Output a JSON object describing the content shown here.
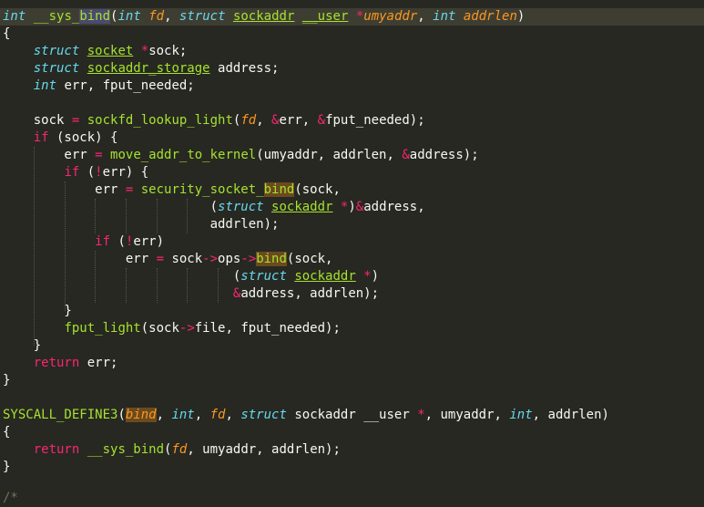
{
  "editor": {
    "code": {
      "l1": [
        "int",
        " ",
        "__sys_",
        "bind",
        "(",
        "int",
        " ",
        "fd",
        ", ",
        "struct",
        " ",
        "sockaddr",
        " ",
        "__user",
        " ",
        "*",
        "umyaddr",
        ", ",
        "int",
        " ",
        "addrlen",
        ")"
      ],
      "l2": [
        "{"
      ],
      "l3": [
        "    ",
        "struct",
        " ",
        "socket",
        " ",
        "*",
        "sock;"
      ],
      "l4": [
        "    ",
        "struct",
        " ",
        "sockaddr_storage",
        " address;"
      ],
      "l5": [
        "    ",
        "int",
        " err, fput_needed;"
      ],
      "l7": [
        "    sock ",
        "=",
        " ",
        "sockfd_lookup_light",
        "(",
        "fd",
        ", ",
        "&",
        "err, ",
        "&",
        "fput_needed);"
      ],
      "l8": [
        "    ",
        "if",
        " (sock) {"
      ],
      "l9": [
        "        err ",
        "=",
        " ",
        "move_addr_to_kernel",
        "(umyaddr, addrlen, ",
        "&",
        "address);"
      ],
      "l10": [
        "        ",
        "if",
        " (",
        "!",
        "err) {"
      ],
      "l11": [
        "            err ",
        "=",
        " ",
        "security_socket_",
        "bind",
        "(sock,"
      ],
      "l12": [
        "                           (",
        "struct",
        " ",
        "sockaddr",
        " ",
        "*",
        ")",
        "&",
        "address,"
      ],
      "l13": [
        "                           addrlen);"
      ],
      "l14": [
        "            ",
        "if",
        " (",
        "!",
        "err)"
      ],
      "l15": [
        "                err ",
        "=",
        " sock",
        "->",
        "ops",
        "->",
        "bind",
        "(sock,"
      ],
      "l16": [
        "                              (",
        "struct",
        " ",
        "sockaddr",
        " ",
        "*",
        ")"
      ],
      "l17": [
        "                              ",
        "&",
        "address, addrlen);"
      ],
      "l18": [
        "        }"
      ],
      "l19": [
        "        ",
        "fput_light",
        "(sock",
        "->",
        "file, fput_needed);"
      ],
      "l20": [
        "    }"
      ],
      "l21": [
        "    ",
        "return",
        " err;"
      ],
      "l22": [
        "}"
      ],
      "l24": [
        "SYSCALL_DEFINE3",
        "(",
        "bind",
        ", ",
        "int",
        ", ",
        "fd",
        ", ",
        "struct",
        " sockaddr __user ",
        "*",
        ", umyaddr, ",
        "int",
        ", addrlen)"
      ],
      "l25": [
        "{"
      ],
      "l26": [
        "    ",
        "return",
        " ",
        "__sys_bind",
        "(",
        "fd",
        ", umyaddr, addrlen);"
      ],
      "l27": [
        "}"
      ],
      "l29": [
        "/*"
      ]
    }
  }
}
